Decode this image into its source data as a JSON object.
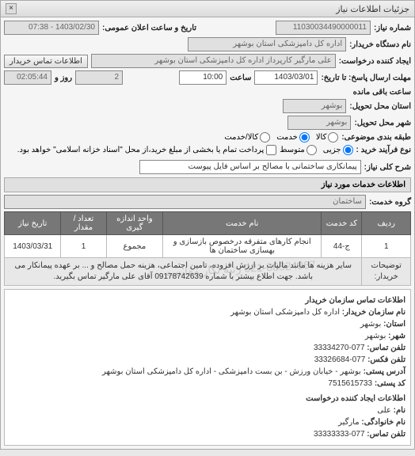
{
  "window": {
    "title": "جزئیات اطلاعات نیاز"
  },
  "fields": {
    "need_no_label": "شماره نیاز:",
    "need_no": "11030034490000011",
    "announce_label": "تاریخ و ساعت اعلان عمومی:",
    "announce_value": "1403/02/30 - 07:38",
    "buyer_device_label": "نام دستگاه خریدار:",
    "buyer_device": "اداره کل دامپزشکی استان بوشهر",
    "requester_label": "ایجاد کننده درخواست:",
    "requester": "علی مارگیر کارپرداز اداره کل دامپزشکی استان بوشهر",
    "contact_btn": "اطلاعات تماس خریدار",
    "deadline_label": "مهلت ارسال پاسخ: تا تاریخ:",
    "deadline_date": "1403/03/01",
    "time_label": "ساعت",
    "deadline_time": "10:00",
    "days_label": "روز و",
    "days_value": "2",
    "remain_time": "02:05:44",
    "remain_label": "ساعت باقی مانده",
    "delivery_province_label": "استان محل تحویل:",
    "delivery_province": "بوشهر",
    "delivery_city_label": "شهر محل تحویل:",
    "delivery_city": "بوشهر",
    "subject_type_label": "طبقه بندی موضوعی:",
    "goods_label": "کالا",
    "service_label": "خدمت",
    "both_label": "کالا/خدمت",
    "process_type_label": "نوع فرآیند خرید :",
    "partial_label": "جزیی",
    "medium_label": "متوسط",
    "payment_note": "پرداخت تمام یا بخشی از مبلغ خرید،از محل \"اسناد خزانه اسلامی\" خواهد بود.",
    "main_desc_label": "شرح کلی نیاز:",
    "main_desc": "پیمانکاری ساختمانی با مصالح بر اساس فایل پیوست"
  },
  "services_section": {
    "header": "اطلاعات خدمات مورد نیاز",
    "group_label": "گروه خدمت:",
    "group_value": "ساختمان"
  },
  "table": {
    "headers": {
      "row": "ردیف",
      "code": "کد خدمت",
      "name": "نام خدمت",
      "unit": "واحد اندازه گیری",
      "qty": "تعداد / مقدار",
      "need_date": "تاریخ نیاز"
    },
    "rows": [
      {
        "row": "1",
        "code": "ج-44",
        "name": "انجام کارهای متفرقه درخصوص بازسازی و بهسازی ساختمان ها",
        "unit": "مجموع",
        "qty": "1",
        "need_date": "1403/03/31"
      }
    ],
    "note_label": "توضیحات خریدار:",
    "note_text": "سایر هزینه ها مانند مالیات بر ارزش افزوده، تامین اجتماعی، هزینه حمل مصالح و ... بر عهده پیمانکار می باشد. جهت اطلاع بیشتر با شماره 09178742639 آقای علی مارگیر تماس بگیرید."
  },
  "org_info": {
    "header": "اطلاعات تماس سازمان خریدار",
    "org_name_label": "نام سازمان خریدار:",
    "org_name": "اداره کل دامپزشکی استان بوشهر",
    "province_label": "استان:",
    "province": "بوشهر",
    "city_label": "شهر:",
    "city": "بوشهر",
    "phone_label": "تلفن تماس:",
    "phone": "077-33334270",
    "fax_label": "تلفن فکس:",
    "fax": "077-33326684",
    "postal_label": "آدرس پستی:",
    "postal": "بوشهر - خیابان ورزش - بن بست دامپزشکی - اداره کل دامپزشکی استان بوشهر",
    "postcode_label": "کد پستی:",
    "postcode": "7515615733",
    "creator_header": "اطلاعات ایجاد کننده درخواست",
    "name_label": "نام:",
    "name": "علی",
    "lname_label": "نام خانوادگی:",
    "lname": "مارگیر",
    "cphone_label": "تلفن تماس:",
    "cphone": "077-33333333"
  },
  "watermark": "021-88324967 رتبه نگار مقایسه"
}
